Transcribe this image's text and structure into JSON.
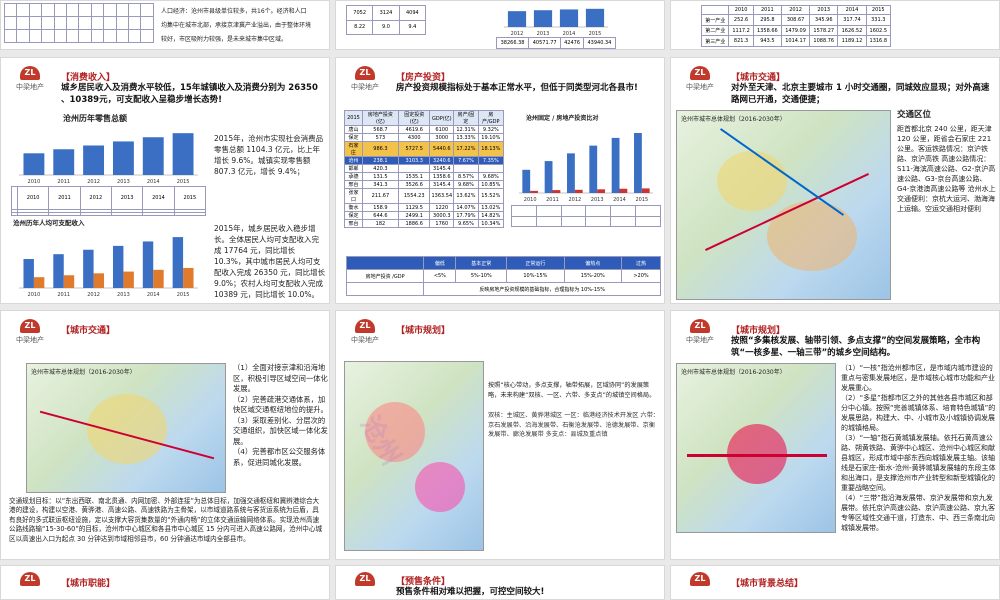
{
  "logo": {
    "text": "中梁地产",
    "mark": "ZL"
  },
  "slides": {
    "top_left": {
      "text_line1": "人口经济：沧州市县级单位较多，共16个。经济和人口",
      "text_line2": "均集中在城市北部，承接京津冀产业溢出，由于整体环境",
      "text_line3": "较好，市区吸附力较强，是未来城市集中区域。"
    },
    "top_mid": {
      "table_headers": [
        "2012",
        "2013",
        "2014",
        "2015"
      ],
      "values": [
        "38266.38",
        "40571.77",
        "42476",
        "43940.34"
      ]
    },
    "top_right": {
      "headers": [
        "2010",
        "2011",
        "2012",
        "2013",
        "2014",
        "2015"
      ],
      "rows": [
        [
          "第一产业",
          "252.6",
          "295.8",
          "308.67",
          "345.96",
          "317.74",
          "331.3"
        ],
        [
          "第二产业",
          "1117.2",
          "1358.66",
          "1479.09",
          "1578.27",
          "1626.52",
          "1602.5"
        ],
        [
          "第三产业",
          "821.3",
          "943.5",
          "1014.17",
          "1088.76",
          "1189.12",
          "1316.8"
        ]
      ]
    },
    "consumption": {
      "tag": "【消费收入】",
      "title": "城乡居民收入及消费水平较低，15年城镇收入及消费分别为 26350 、10389元，可支配收入呈稳步增长态势!",
      "chart_title": "沧州历年零售总额",
      "chart2_title": "沧州历年人均可支配收入",
      "p1": "2015年，沧州市实现社会消费品零售总额 1104.3 亿元，比上年增长 9.6%。城镇实现零售额 807.3 亿元，增长 9.4%；",
      "p2": "2015年，城乡居民收入稳步增长。全体居民人均可支配收入完成 17764 元，同比增长 10.3%，其中城市居民人均可支配收入完成 26350 元，同比增长 9.0%；农村人均可支配收入完成 10389 元，同比增长 10.0%。",
      "years": [
        "2010",
        "2011",
        "2012",
        "2013",
        "2014",
        "2015"
      ]
    },
    "realestate": {
      "tag": "【房产投资】",
      "title": "房产投资规模指标处于基本正常水平，但低于同类型河北各县市!",
      "table_headers": [
        "2015",
        "房地产投资(亿)",
        "固定投资(亿)",
        "GDP(亿)",
        "房产/固定",
        "房产/GDP"
      ],
      "rows": [
        [
          "唐山",
          "568.7",
          "4619.6",
          "6100",
          "12.31%",
          "9.32%"
        ],
        [
          "保定",
          "573",
          "4300",
          "3000",
          "13.33%",
          "19.10%"
        ],
        [
          "石家庄",
          "986.3",
          "5727.5",
          "5440.6",
          "17.22%",
          "18.13%"
        ],
        [
          "沧州",
          "238.1",
          "3103.3",
          "3240.6",
          "7.67%",
          "7.35%"
        ],
        [
          "邯郸",
          "420.3",
          "",
          "3145.4",
          "",
          ""
        ],
        [
          "承德",
          "131.5",
          "1535.1",
          "1358.6",
          "8.57%",
          "9.68%"
        ],
        [
          "邢台",
          "341.3",
          "3526.6",
          "3145.4",
          "9.68%",
          "10.85%"
        ],
        [
          "张家口",
          "211.67",
          "1554.23",
          "1363.54",
          "13.62%",
          "15.52%"
        ],
        [
          "衡水",
          "158.9",
          "1129.5",
          "1220",
          "14.07%",
          "13.02%"
        ],
        [
          "保定",
          "644.6",
          "2499.1",
          "3000.3",
          "17.79%",
          "14.82%"
        ],
        [
          "邢台",
          "182",
          "1886.6",
          "1760",
          "9.65%",
          "10.34%"
        ]
      ],
      "chart_title": "沧州固定 / 房地产投资比对",
      "scale_headers": [
        "",
        "偏低",
        "基本正常",
        "正常运行",
        "偏热点",
        "过热"
      ],
      "scale_row_label": "房地产投资 /GDP",
      "scale_values": [
        "<5%",
        "5%-10%",
        "10%-15%",
        "15%-20%",
        ">20%"
      ],
      "scale_note": "反映房地产投资规模的基础指标，合理指标为 10%-15%"
    },
    "traffic1": {
      "tag": "【城市交通】",
      "title": "对外至天津、北京主要城市 1 小时交通圈，同城效应显现；对外高速路网已开通，交通便捷；",
      "map_title": "沧州市城市总体规划（2016-2030年）",
      "side_title": "交通区位",
      "side_text": "距首都北京 240 公里，距天津 120 公里，距省会石家庄 221 公里。客运铁路情况：京沪铁路、京沪高铁 高速公路情况：S11-海滨高速公路、G2-京沪高速公路、G3-京台高速公路、G4-京港澳高速公路等 沧州水上交通便利：京杭大运河、渤海海上运输。空运交通相对便利"
    },
    "traffic2": {
      "tag": "【城市交通】",
      "map_title": "沧州市城市总体规划（2016-2030年）",
      "list": [
        "（1）全面对接京津和沿海地区，积极引导区域空间一体化发展。",
        "（2）完善疏港交通体系，加快区域交通枢纽地位的提升。",
        "（3）采取差别化、分层次的交通组织，加快区域一体化发展。",
        "（4）完善都市区公交服务体系，促进同城化发展。"
      ],
      "bottom": "交通规划目标：以“东出西联、南北贯通、内网加密、外部连接”为总体目标，加强交通枢纽和冀辨港综合大港的建设，构建以空港、黄骅港、高速公路、高速铁路为主骨架，以市域道路系统与客货运系统为后盾，具有良好的多式联运枢纽设施，定以支撑大容货集数量的“外通内畅”的立体交通运输网络体系。实现沧州高速公路线路输“15-30-60”的目标，沧州市中心城区和各县市中心城区 15 分内可进入高速公路网，沧州中心城区以高速出入口为起点 30 分钟达到市域相邻县市，60 分钟通达市域内全部县市。"
    },
    "planning1": {
      "tag": "【城市规划】",
      "text_title": "按照“核心带动，多点支撑，轴带拓展，区域协同”的发展策略，未来构建“双核、一区、六带、多支点”的城镇空间格局。",
      "text_body": "双核：主城区、黄骅港城区 一区：临港经济技术开发区 六带：京石发展带、沿海发展带、石衡沧发展带、沧德发展带、京衡发展带、廊沧发展带 多支点：县城及重点镇"
    },
    "planning2": {
      "tag": "【城市规划】",
      "title": "按照“多集核发展、轴带引领、多点支撑”的空间发展策略，全市构筑“一核多星、一轴三带”的城乡空间结构。",
      "map_title": "沧州市城市总体规划（2016-2030年）",
      "list": [
        "（1）“一核”指沧州都市区，是市域内城市建设的重点与密集发展地区，是市域核心城市功能和产业发展重心。",
        "（2）“多星”指都市区之外的其他各县市城区和部分中心镇。按照“完善城镇体系、培育特色城镇”的发展思路，构建大、中、小城市及小城镇协调发展的城镇格局。",
        "（3）“一轴”指石黄城镇发展轴。依托石黄高速公路、朔黄铁路、黄骅中心城区、沧州中心城区和献县城区，形成市域中部东西向城镇发展主轴。该轴线是石家庄-衡水-沧州-黄骅城镇发展轴的东段主体和出海口，是支撑沧州市产业转型和新型城镇化的重要战略空间。",
        "（4）“三带”指沿海发展带、京沪发展带和京九发展带。依托京沪高速公路、京沪高速公路、京九客专等区域性交通干道，打造东、中、西三条南北向城镇发展带。"
      ]
    },
    "bottom_left": {
      "tag": "【城市职能】"
    },
    "bottom_mid": {
      "tag": "【预售条件】",
      "title": "预售条件相对难以把握，可控空间较大!"
    },
    "bottom_right": {
      "tag": "【城市背景总结】"
    }
  },
  "chart_data": [
    {
      "type": "bar",
      "title": "沧州历年零售总额",
      "categories": [
        "2010",
        "2011",
        "2012",
        "2013",
        "2014",
        "2015"
      ],
      "series": [
        {
          "name": "零售总额",
          "values": [
            573,
            679.4,
            779.5,
            886.2,
            996.99,
            1104.3
          ]
        }
      ]
    },
    {
      "type": "bar",
      "title": "沧州历年人均可支配收入",
      "categories": [
        "2010",
        "2011",
        "2012",
        "2013",
        "2014",
        "2015"
      ],
      "series": [
        {
          "name": "城镇",
          "values": [
            15000,
            17500,
            19800,
            21800,
            24100,
            26350
          ]
        },
        {
          "name": "农村",
          "values": [
            5600,
            6600,
            7600,
            8500,
            9400,
            10389
          ]
        }
      ]
    },
    {
      "type": "bar",
      "title": "沧州固定 / 房地产投资比对",
      "categories": [
        "2010",
        "2011",
        "2012",
        "2013",
        "2014",
        "2015"
      ],
      "series": [
        {
          "name": "固定投资",
          "values": [
            1200,
            1650,
            2050,
            2450,
            2850,
            3103
          ]
        },
        {
          "name": "房地产投资",
          "values": [
            110,
            150,
            165,
            190,
            220,
            238
          ]
        }
      ]
    }
  ]
}
